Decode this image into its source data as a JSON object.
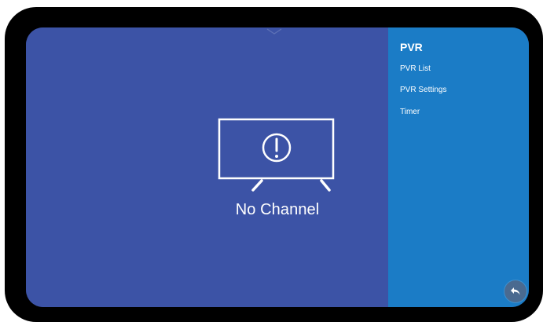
{
  "screen": {
    "message": "No Channel",
    "graphic_icon": "tv-warning-icon"
  },
  "side_panel": {
    "title": "PVR",
    "items": [
      {
        "label": "PVR List"
      },
      {
        "label": "PVR Settings"
      },
      {
        "label": "Timer"
      }
    ]
  },
  "back_button": {
    "icon": "back-arrow-icon"
  },
  "colors": {
    "main_background": "#3c53a6",
    "panel_background": "#1b7cc6",
    "bezel": "#000000",
    "back_button": "#4a6a90"
  }
}
